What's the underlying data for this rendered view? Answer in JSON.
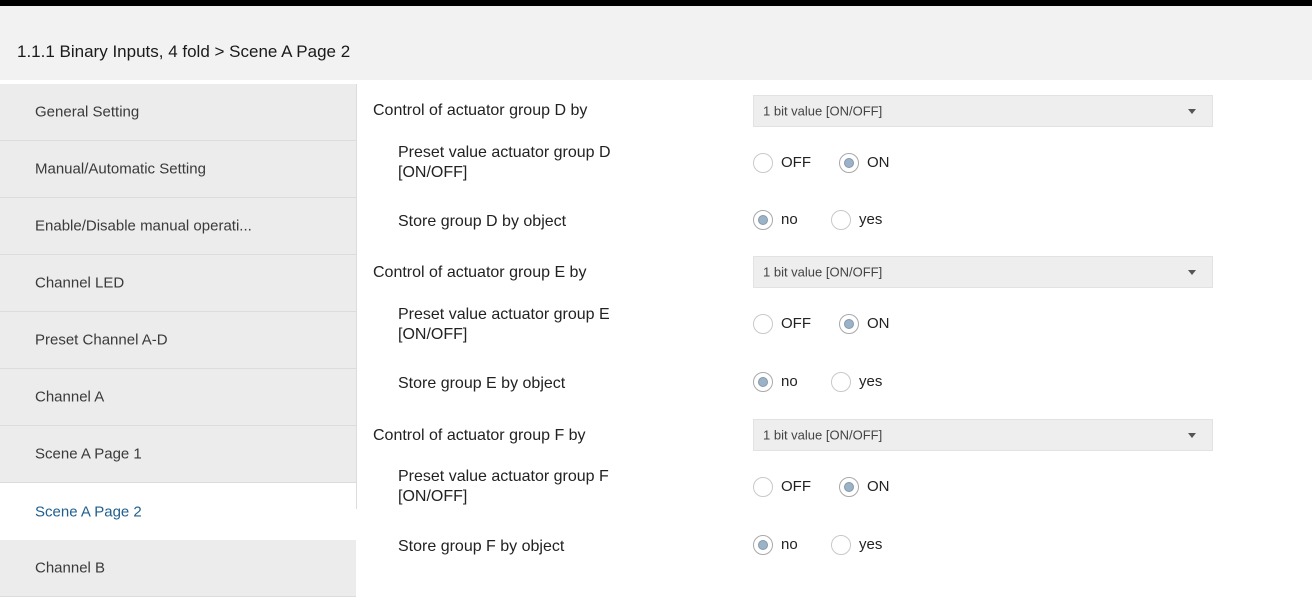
{
  "header": {
    "title": "1.1.1 Binary Inputs, 4 fold > Scene A Page 2"
  },
  "sidebar": {
    "items": [
      {
        "label": "General Setting"
      },
      {
        "label": "Manual/Automatic Setting"
      },
      {
        "label": "Enable/Disable manual operati..."
      },
      {
        "label": "Channel LED"
      },
      {
        "label": "Preset Channel A-D"
      },
      {
        "label": "Channel A"
      },
      {
        "label": "Scene A Page 1"
      },
      {
        "label": "Scene A Page 2",
        "active": true
      },
      {
        "label": "Channel B"
      }
    ]
  },
  "main": {
    "groups": [
      {
        "control_label": "Control of actuator group D by",
        "control_value": "1 bit value [ON/OFF]",
        "preset_label_line1": "Preset value actuator group D",
        "preset_label_line2": "[ON/OFF]",
        "preset_off": "OFF",
        "preset_on": "ON",
        "preset_selected": "ON",
        "store_label": "Store group D by object",
        "store_no": "no",
        "store_yes": "yes",
        "store_selected": "no"
      },
      {
        "control_label": "Control of actuator group E by",
        "control_value": "1 bit value [ON/OFF]",
        "preset_label_line1": "Preset value actuator group E",
        "preset_label_line2": "[ON/OFF]",
        "preset_off": "OFF",
        "preset_on": "ON",
        "preset_selected": "ON",
        "store_label": "Store group E by object",
        "store_no": "no",
        "store_yes": "yes",
        "store_selected": "no"
      },
      {
        "control_label": "Control of actuator group F by",
        "control_value": "1 bit value [ON/OFF]",
        "preset_label_line1": "Preset value actuator group F",
        "preset_label_line2": "[ON/OFF]",
        "preset_off": "OFF",
        "preset_on": "ON",
        "preset_selected": "ON",
        "store_label": "Store group F by object",
        "store_no": "no",
        "store_yes": "yes",
        "store_selected": "no"
      }
    ]
  },
  "colors": {
    "active_nav_text": "#1f5f8f",
    "nav_background": "#ececec",
    "radio_checked_dot": "#9cb2c6"
  },
  "icons": {
    "dropdown": "chevron-down-icon"
  }
}
